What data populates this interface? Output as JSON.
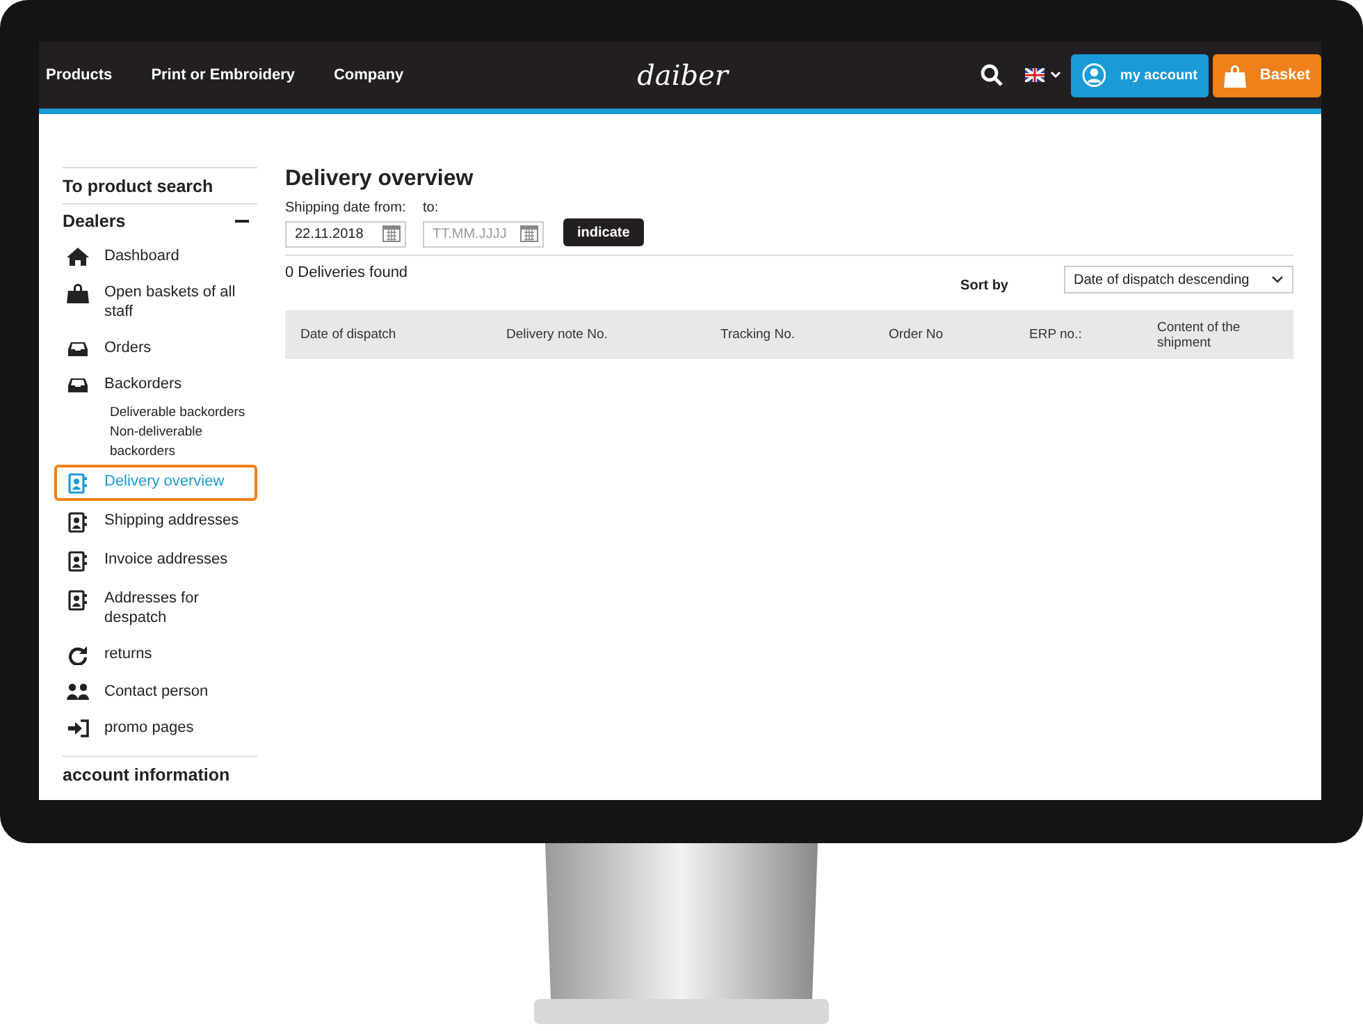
{
  "nav": {
    "links": [
      "Products",
      "Print or Embroidery",
      "Company"
    ],
    "logo": "daiber",
    "account": "my account",
    "basket": "Basket"
  },
  "sidebar": {
    "search_link": "To product search",
    "section": {
      "title": "Dealers",
      "expanded": true,
      "items": [
        {
          "label": "Dashboard",
          "selected": false
        },
        {
          "label": "Open baskets of all staff",
          "selected": false
        },
        {
          "label": "Orders",
          "selected": false
        },
        {
          "label": "Backorders",
          "selected": false,
          "children": [
            {
              "label": "Deliverable backorders"
            },
            {
              "label": "Non-deliverable backorders"
            }
          ]
        },
        {
          "label": "Delivery overview",
          "selected": true
        },
        {
          "label": "Shipping addresses",
          "selected": false
        },
        {
          "label": "Invoice addresses",
          "selected": false
        },
        {
          "label": "Addresses for despatch",
          "selected": false
        },
        {
          "label": "returns",
          "selected": false
        },
        {
          "label": "Contact person",
          "selected": false
        },
        {
          "label": "promo pages",
          "selected": false
        }
      ]
    },
    "next_section": "account information"
  },
  "main": {
    "title": "Delivery overview",
    "from_label": "Shipping date from:",
    "from_value": "22.11.2018",
    "to_label": "to:",
    "to_placeholder": "TT.MM.JJJJ",
    "button": "indicate",
    "count": "0 Deliveries found",
    "sort_label": "Sort by",
    "sort_value": "Date of dispatch descending",
    "columns": [
      "Date of dispatch",
      "Delivery note No.",
      "Tracking No.",
      "Order No",
      "ERP no.:",
      "Content of the shipment"
    ]
  }
}
